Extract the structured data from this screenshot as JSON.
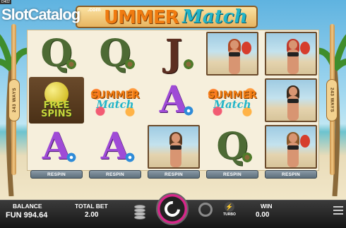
{
  "branding": {
    "watermark": "SlotCatalog",
    "watermark_suffix": ".com",
    "corner_tag": "D402",
    "title_main": "UMMER",
    "title_script": "Match"
  },
  "signs": {
    "left": "243 WAYS",
    "right": "243 WAYS"
  },
  "reels": [
    {
      "symbols": [
        {
          "kind": "letter",
          "text": "Q",
          "style": "q",
          "deco": "palm"
        },
        {
          "kind": "free",
          "line1": "FREE",
          "line2": "SPINS"
        },
        {
          "kind": "letter",
          "text": "A",
          "style": "a",
          "deco": "flower"
        }
      ]
    },
    {
      "symbols": [
        {
          "kind": "letter",
          "text": "Q",
          "style": "q",
          "deco": "palm"
        },
        {
          "kind": "wild",
          "top": "SUMMER",
          "bottom": "Match"
        },
        {
          "kind": "letter",
          "text": "A",
          "style": "a",
          "deco": "flower"
        }
      ]
    },
    {
      "symbols": [
        {
          "kind": "letter",
          "text": "J",
          "style": "j",
          "deco": "palm"
        },
        {
          "kind": "letter",
          "text": "A",
          "style": "a",
          "deco": "flower"
        },
        {
          "kind": "photo",
          "hair": "#5a3a22"
        }
      ]
    },
    {
      "symbols": [
        {
          "kind": "photo",
          "hair": "#b04a26",
          "paddle": true
        },
        {
          "kind": "wild",
          "top": "SUMMER",
          "bottom": "Match"
        },
        {
          "kind": "letter",
          "text": "Q",
          "style": "q",
          "deco": "palm"
        }
      ]
    },
    {
      "symbols": [
        {
          "kind": "photo",
          "hair": "#c0392b",
          "paddle": true
        },
        {
          "kind": "photo",
          "hair": "#3a2a1c"
        },
        {
          "kind": "photo",
          "hair": "#8a5a2b",
          "paddle": true
        }
      ]
    }
  ],
  "respin_label": "RESPIN",
  "footer": {
    "balance_label": "BALANCE",
    "balance_value": "FUN 994.64",
    "bet_label": "TOTAL BET",
    "bet_value": "2.00",
    "turbo_label": "TURBO",
    "win_label": "WIN",
    "win_value": "0.00"
  },
  "colors": {
    "spin_ring": "#d7278a",
    "title_orange": "#f07b10",
    "title_teal": "#23b5c9"
  }
}
